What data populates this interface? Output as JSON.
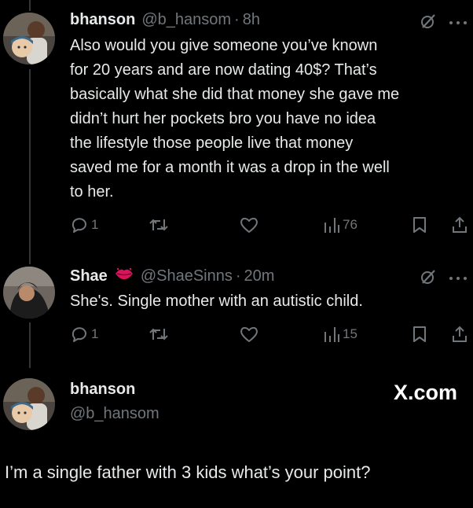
{
  "tweets": [
    {
      "name": "bhanson",
      "handle": "@b_hansom",
      "separator": "·",
      "time": "8h",
      "text_lines": [
        "Also would you give someone you’ve known",
        "for 20 years and are now dating 40$? That’s",
        "basically what she did that money she gave me",
        "didn’t hurt her pockets bro you have no idea",
        "the lifestyle those people live that money",
        "saved me for a month it was a drop in the well",
        "to her."
      ],
      "replies": "1",
      "views": "76",
      "icons": [
        "grok-icon",
        "more-icon",
        "reply-icon",
        "retweet-icon",
        "like-icon",
        "views-icon",
        "bookmark-icon",
        "share-icon"
      ]
    },
    {
      "name": "Shae",
      "badge": "lips-emoji",
      "handle": "@ShaeSinns",
      "separator": "·",
      "time": "20m",
      "text_lines": [
        "She's. Single mother with an autistic child."
      ],
      "replies": "1",
      "views": "15"
    }
  ],
  "card": {
    "name": "bhanson",
    "handle": "@b_hansom",
    "brand": "X.com",
    "reply_text": "I’m a single father with 3 kids what’s your point?"
  },
  "colors": {
    "background": "#000000",
    "text": "#e7e9ea",
    "muted": "#71767b",
    "thread_line": "#333639"
  }
}
